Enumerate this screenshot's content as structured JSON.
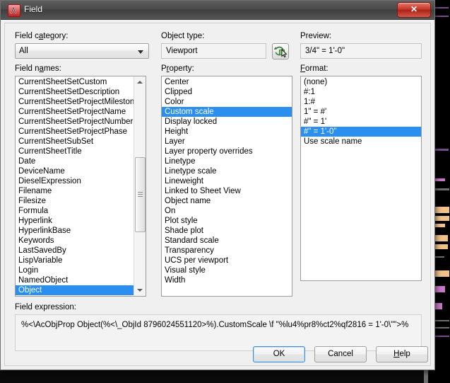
{
  "window": {
    "title": "Field",
    "icon": "autocad-a-icon",
    "close_label": "✕"
  },
  "field_category": {
    "label": "Field category:",
    "label_accel_before": "Field c",
    "label_accel": "a",
    "label_accel_after": "tegory:",
    "value": "All",
    "options": [
      "All"
    ]
  },
  "field_names": {
    "label": "Field names:",
    "selected": "Object",
    "items": [
      "CurrentSheetSetCustom",
      "CurrentSheetSetDescription",
      "CurrentSheetSetProjectMilestone",
      "CurrentSheetSetProjectName",
      "CurrentSheetSetProjectNumber",
      "CurrentSheetSetProjectPhase",
      "CurrentSheetSubSet",
      "CurrentSheetTitle",
      "Date",
      "DeviceName",
      "DieselExpression",
      "Filename",
      "Filesize",
      "Formula",
      "Hyperlink",
      "HyperlinkBase",
      "Keywords",
      "LastSavedBy",
      "LispVariable",
      "Login",
      "NamedObject",
      "Object"
    ]
  },
  "object_type": {
    "label": "Object type:",
    "value": "Viewport",
    "pick_button": "select-object-button"
  },
  "property": {
    "label": "Property:",
    "selected": "Custom scale",
    "items": [
      "Center",
      "Clipped",
      "Color",
      "Custom scale",
      "Display locked",
      "Height",
      "Layer",
      "Layer property overrides",
      "Linetype",
      "Linetype scale",
      "Lineweight",
      "Linked to Sheet View",
      "Object name",
      "On",
      "Plot style",
      "Shade plot",
      "Standard scale",
      "Transparency",
      "UCS per viewport",
      "Visual style",
      "Width"
    ]
  },
  "preview": {
    "label": "Preview:",
    "value": "3/4\" = 1'-0\""
  },
  "format": {
    "label": "Format:",
    "selected": "#\" = 1'-0\"",
    "items": [
      "(none)",
      "#:1",
      "1:#",
      "1\" = #'",
      "#\" = 1'",
      "#\" = 1'-0\"",
      "Use scale name"
    ]
  },
  "field_expression": {
    "label": "Field expression:",
    "value": "%<\\AcObjProp Object(%<\\_ObjId 8796024551120>%).CustomScale \\f \"%lu4%pr8%ct2%qf2816 = 1'-0\\\"\">%"
  },
  "buttons": {
    "ok": "OK",
    "cancel": "Cancel",
    "help_before": "",
    "help_accel": "H",
    "help_after": "elp",
    "help": "Help"
  },
  "colors": {
    "selection_blue": "#2a8fef",
    "titlebar_dark": "#4a4a4a",
    "close_red": "#c8372a",
    "dialog_face": "#f0f0f0"
  }
}
